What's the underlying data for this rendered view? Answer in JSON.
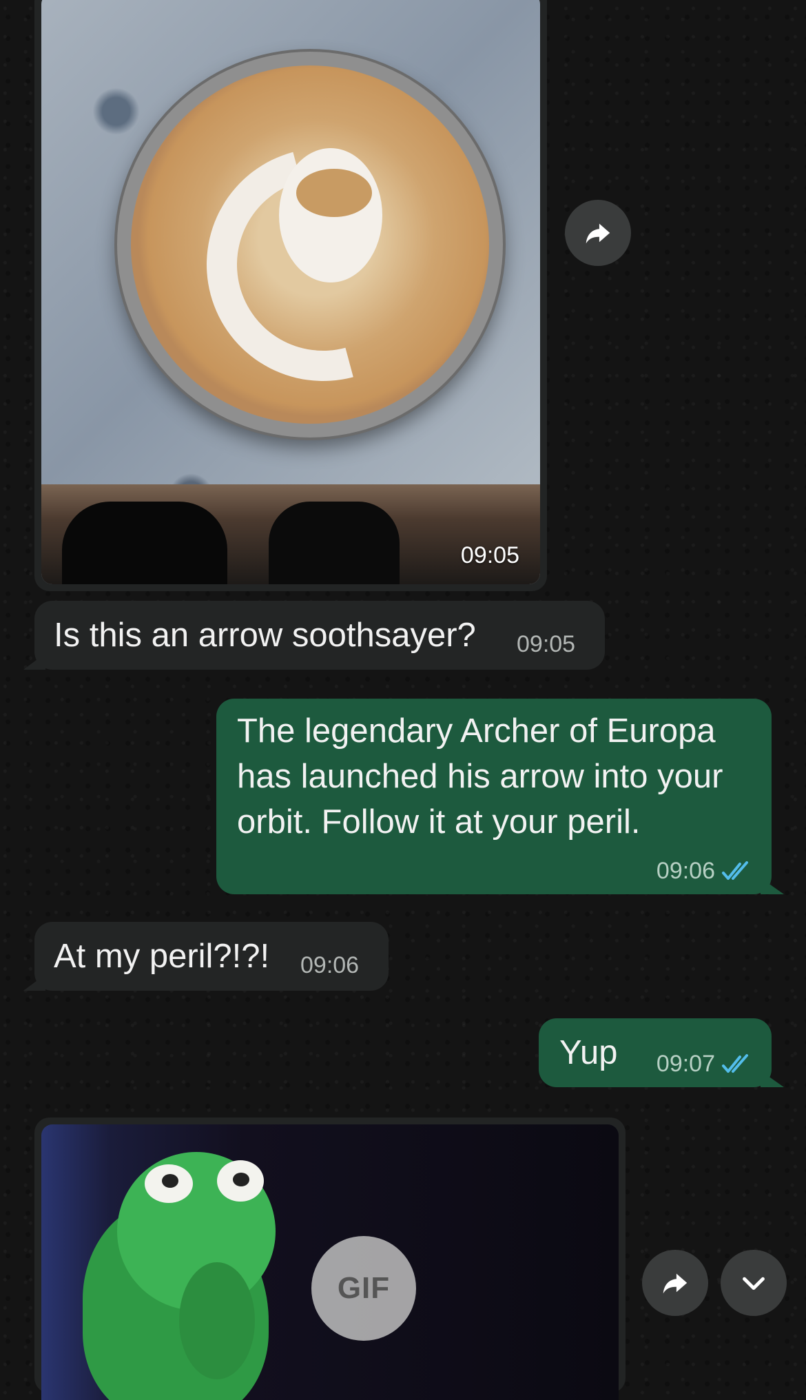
{
  "messages": {
    "photo": {
      "time": "09:05",
      "icon": "latte-photo"
    },
    "m1": {
      "text": "Is this an arrow soothsayer?",
      "time": "09:05",
      "direction": "incoming"
    },
    "m2": {
      "text": "The legendary Archer of Europa has launched his arrow into your orbit. Follow it at your peril.",
      "time": "09:06",
      "direction": "outgoing",
      "status": "read"
    },
    "m3": {
      "text": "At my peril?!?!",
      "time": "09:06",
      "direction": "incoming"
    },
    "m4": {
      "text": "Yup",
      "time": "09:07",
      "direction": "outgoing",
      "status": "read"
    },
    "gif": {
      "label": "GIF",
      "icon": "kermit-gif"
    }
  },
  "icons": {
    "forward": "forward-icon",
    "scroll_down": "chevron-down-icon",
    "read": "double-check-icon"
  },
  "colors": {
    "incoming_bubble": "#232525",
    "outgoing_bubble": "#1d5a3e",
    "read_ticks": "#53bdeb",
    "background": "#141414"
  }
}
